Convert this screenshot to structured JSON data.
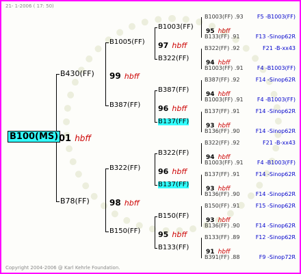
{
  "header": "21- 1-2006 ( 17: 50)",
  "copyright": "Copyright 2004-2006 @ Karl Kehrle Foundation.",
  "root": {
    "name": "B100(MS)",
    "num": "01",
    "code": "hbff"
  },
  "level2": [
    {
      "name": "B430(FF)",
      "num": "99",
      "code": "hbff"
    },
    {
      "name": "B78(FF)",
      "num": "98",
      "code": "hbff"
    }
  ],
  "level3": [
    {
      "name": "B1005(FF)",
      "num": "97",
      "code": "hbff"
    },
    {
      "name": "B387(FF)",
      "num": "96",
      "code": "hbff"
    },
    {
      "name": "B322(FF)",
      "num": "96",
      "code": "hbff"
    },
    {
      "name": "B150(FF)",
      "num": "95",
      "code": "hbff"
    }
  ],
  "level4": [
    {
      "name": "B1003(FF)",
      "num": "95",
      "code": "hbff"
    },
    {
      "name": "B322(FF)",
      "num": "94",
      "code": "hbff"
    },
    {
      "name": "B387(FF)",
      "num": "94",
      "code": "hbff"
    },
    {
      "name": "B137(FF)",
      "num": "93",
      "code": "hbff"
    },
    {
      "name": "B322(FF)",
      "num": "94",
      "code": "hbff"
    },
    {
      "name": "B137(FF)",
      "num": "93",
      "code": "hbff"
    },
    {
      "name": "B150(FF)",
      "num": "93",
      "code": "hbff"
    },
    {
      "name": "B133(FF)",
      "num": "91",
      "code": "hbff"
    }
  ],
  "level5": [
    {
      "left": "B1003(FF) .93",
      "right": "F5 -B1003(FF)"
    },
    {
      "left": "B133(FF) .91",
      "right": "F13 -Sinop62R"
    },
    {
      "left": "B322(FF) .92",
      "right": "F21 -B-xx43"
    },
    {
      "left": "B1003(FF) .91",
      "right": "F4 -B1003(FF)"
    },
    {
      "left": "B387(FF) .92",
      "right": "F14 -Sinop62R"
    },
    {
      "left": "B1003(FF) .91",
      "right": "F4 -B1003(FF)"
    },
    {
      "left": "B137(FF) .91",
      "right": "F14 -Sinop62R"
    },
    {
      "left": "B136(FF) .90",
      "right": "F14 -Sinop62R"
    },
    {
      "left": "B322(FF) .92",
      "right": "F21 -B-xx43"
    },
    {
      "left": "B1003(FF) .91",
      "right": "F4 -B1003(FF)"
    },
    {
      "left": "B137(FF) .91",
      "right": "F14 -Sinop62R"
    },
    {
      "left": "B136(FF) .90",
      "right": "F14 -Sinop62R"
    },
    {
      "left": "B150(FF) .91",
      "right": "F15 -Sinop62R"
    },
    {
      "left": "B136(FF) .90",
      "right": "F14 -Sinop62R"
    },
    {
      "left": "B133(FF) .89",
      "right": "F12 -Sinop62R"
    },
    {
      "left": "B391(FF) .88",
      "right": "F9 -Sinop72R"
    }
  ]
}
